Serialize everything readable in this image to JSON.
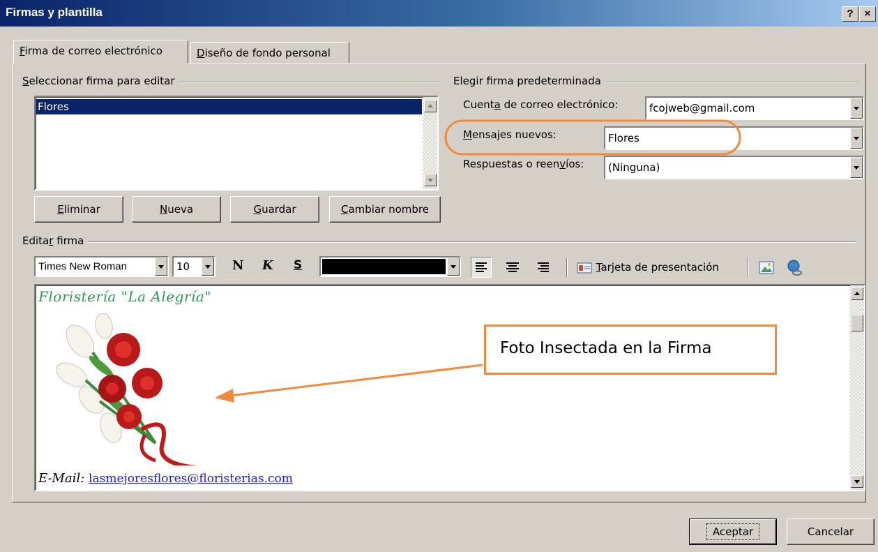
{
  "window": {
    "title": "Firmas y plantilla",
    "help": "?",
    "close": "×"
  },
  "tabs": [
    {
      "pre": "",
      "acc": "F",
      "post": "irma de correo electrónico"
    },
    {
      "pre": "",
      "acc": "D",
      "post": "iseño de fondo personal"
    }
  ],
  "select_group": {
    "title_pre": "",
    "title_acc": "S",
    "title_post": "eleccionar firma para editar",
    "items": [
      "Flores"
    ],
    "buttons": [
      {
        "pre": "",
        "acc": "E",
        "post": "liminar"
      },
      {
        "pre": "",
        "acc": "N",
        "post": "ueva"
      },
      {
        "pre": "",
        "acc": "G",
        "post": "uardar"
      },
      {
        "pre": "",
        "acc": "C",
        "post": "ambiar nombre"
      }
    ]
  },
  "default_group": {
    "title": "Elegir firma predeterminada",
    "account_label": {
      "pre": "Cuent",
      "acc": "a",
      "post": " de correo electrónico:"
    },
    "account_value": "fcojweb@gmail.com",
    "new_label": {
      "pre": "",
      "acc": "M",
      "post": "ensajes nuevos:"
    },
    "new_value": "Flores",
    "reply_label": {
      "pre": "Respuestas o reen",
      "acc": "v",
      "post": "íos:"
    },
    "reply_value": "(Ninguna)"
  },
  "edit_group": {
    "title_pre": "Edita",
    "title_acc": "r",
    "title_post": " firma",
    "font": "Times New Roman",
    "size": "10",
    "bold": "N",
    "italic": "K",
    "underline": "S",
    "color": "#000000",
    "vcard_pre": "",
    "vcard_acc": "T",
    "vcard_post": "arjeta de presentación"
  },
  "signature": {
    "heading": "Floristería \"La Alegría\"",
    "heading_color": "#2e9a4e",
    "email_label": "E-Mail:",
    "email": "lasmejoresflores@floristerias.com"
  },
  "annotation": {
    "text": "Foto Insectada en la Firma",
    "color": "#f08a3c"
  },
  "footer": {
    "ok": "Aceptar",
    "cancel": "Cancelar"
  }
}
